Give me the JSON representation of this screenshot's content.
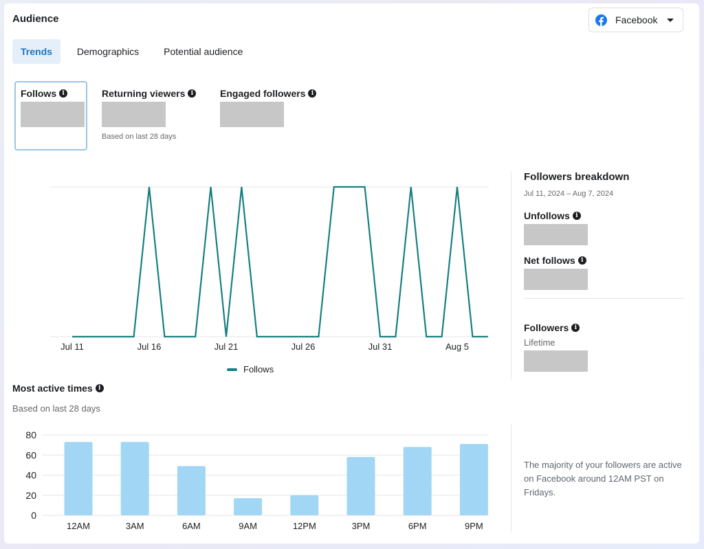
{
  "header": {
    "title": "Audience",
    "platform_select": {
      "selected": "Facebook",
      "icon": "facebook-icon"
    }
  },
  "tabs": [
    {
      "label": "Trends",
      "active": true
    },
    {
      "label": "Demographics",
      "active": false
    },
    {
      "label": "Potential audience",
      "active": false
    }
  ],
  "metrics": [
    {
      "label": "Follows",
      "value": "[redacted]",
      "selected": true
    },
    {
      "label": "Returning viewers",
      "value": "[redacted]",
      "subtitle": "Based on last 28 days"
    },
    {
      "label": "Engaged followers",
      "value": "[redacted]"
    }
  ],
  "follows_legend": "Follows",
  "breakdown": {
    "title": "Followers breakdown",
    "date_range": "Jul 11, 2024 – Aug 7, 2024",
    "unfollows_label": "Unfollows",
    "net_follows_label": "Net follows",
    "followers_label": "Followers",
    "followers_sub": "Lifetime"
  },
  "most_active": {
    "title": "Most active times",
    "subtitle": "Based on last 28 days",
    "insight": "The majority of your followers are active on Facebook around 12AM PST on Fridays."
  },
  "colors": {
    "accent": "#1b75bb",
    "line": "#177f82",
    "bar": "#a2d6f5",
    "facebook": "#1877f2",
    "grid": "#e4e6eb"
  },
  "chart_data": [
    {
      "type": "line",
      "title": "Follows",
      "x": [
        "Jul 11",
        "Jul 12",
        "Jul 13",
        "Jul 14",
        "Jul 15",
        "Jul 16",
        "Jul 17",
        "Jul 18",
        "Jul 19",
        "Jul 20",
        "Jul 21",
        "Jul 22",
        "Jul 23",
        "Jul 24",
        "Jul 25",
        "Jul 26",
        "Jul 27",
        "Jul 28",
        "Jul 29",
        "Jul 30",
        "Jul 31",
        "Aug 1",
        "Aug 2",
        "Aug 3",
        "Aug 4",
        "Aug 5",
        "Aug 6",
        "Aug 7"
      ],
      "series": [
        {
          "name": "Follows",
          "values": [
            0,
            0,
            0,
            0,
            0,
            1,
            0,
            0,
            0,
            1,
            0,
            1,
            0,
            0,
            0,
            0,
            0,
            1,
            1,
            1,
            0,
            0,
            1,
            0,
            0,
            1,
            0,
            0
          ]
        }
      ],
      "x_tick_labels": [
        "Jul 11",
        "Jul 16",
        "Jul 21",
        "Jul 26",
        "Jul 31",
        "Aug 5"
      ],
      "ylim": [
        0,
        1
      ],
      "y_tick_labels_visible": false,
      "grid": true,
      "legend": "bottom-center"
    },
    {
      "type": "bar",
      "title": "Most active times",
      "categories": [
        "12AM",
        "3AM",
        "6AM",
        "9AM",
        "12PM",
        "3PM",
        "6PM",
        "9PM"
      ],
      "values": [
        73,
        73,
        49,
        17,
        20,
        58,
        68,
        71
      ],
      "ylim": [
        0,
        80
      ],
      "y_ticks": [
        0,
        20,
        40,
        60,
        80
      ],
      "xlabel": "",
      "ylabel": "",
      "grid": true
    }
  ]
}
